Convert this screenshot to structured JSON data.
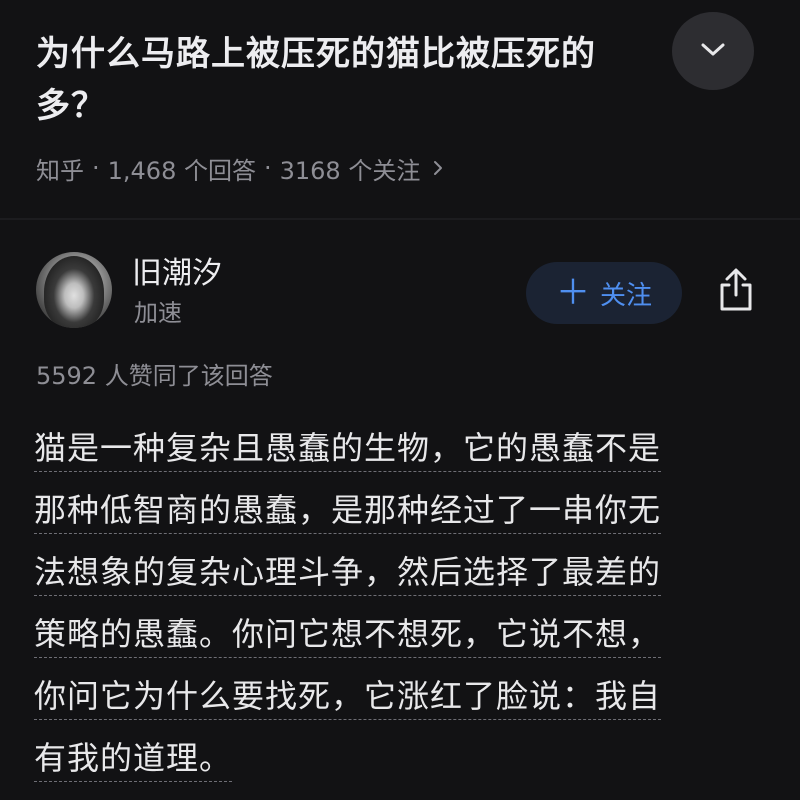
{
  "question": {
    "title": "为什么马路上被压死的猫比被压死的狗多？",
    "title_line1": "为什么马路上被压死的猫比被压死的",
    "title_line2": "多？",
    "collapse_icon": "chevron-down-icon"
  },
  "meta": {
    "source": "知乎",
    "sep1": "·",
    "answers": "1,468 个回答",
    "sep2": "·",
    "followers": "3168 个关注",
    "chevron_icon": "chevron-right-icon"
  },
  "author": {
    "name": "旧潮汐",
    "badge": "加速",
    "follow_label": "关注",
    "follow_icon": "plus-icon",
    "share_icon": "share-icon"
  },
  "answer": {
    "likes": "5592 人赞同了该回答",
    "lines": [
      "猫是一种复杂且愚蠢的生物，它的愚蠢不是",
      "那种低智商的愚蠢，是那种经过了一串你无",
      "法想象的复杂心理斗争，然后选择了最差的",
      "策略的愚蠢。你问它想不想死，它说不想，",
      "你问它为什么要找死，它涨红了脸说：我自",
      "有我的道理。"
    ]
  },
  "colors": {
    "background": "#121214",
    "accent": "#4f8ff0",
    "follow_bg": "#1b2333",
    "muted_text": "#8e8e95"
  }
}
